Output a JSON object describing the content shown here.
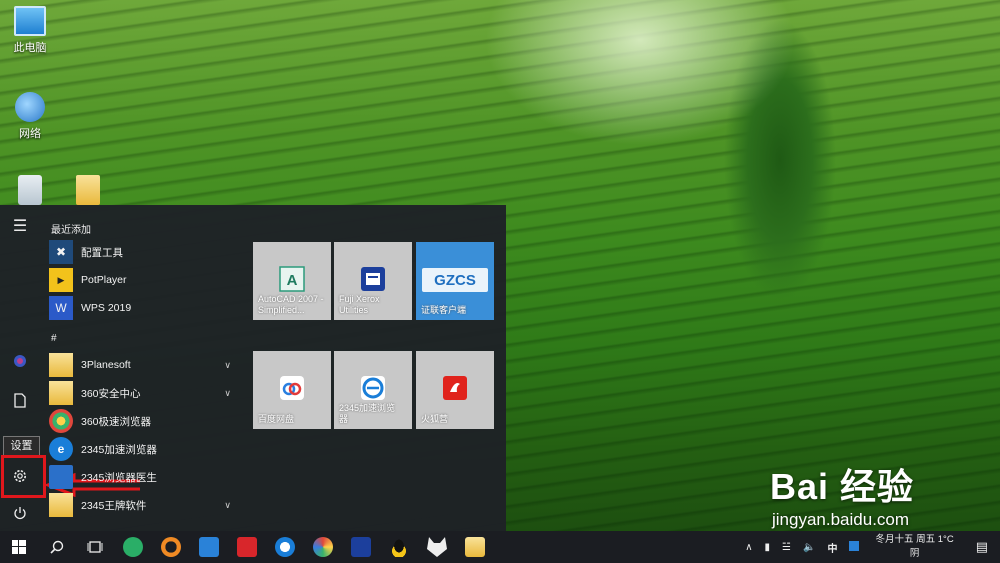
{
  "desktop": {
    "icons": [
      {
        "label": "此电脑",
        "icon": "computer-icon"
      },
      {
        "label": "网络",
        "icon": "network-icon"
      },
      {
        "label": "",
        "icon": "recycle-bin-icon"
      },
      {
        "label": "",
        "icon": "folder-icon"
      }
    ]
  },
  "start_menu": {
    "rail": {
      "menu_icon": "hamburger-menu-icon",
      "tooltip": "设置"
    },
    "recent_header": "最近添加",
    "recent_apps": [
      {
        "label": "配置工具"
      },
      {
        "label": "PotPlayer"
      },
      {
        "label": "WPS 2019"
      }
    ],
    "hash_header": "#",
    "apps": [
      {
        "label": "3Planesoft",
        "expandable": true
      },
      {
        "label": "360安全中心",
        "expandable": true
      },
      {
        "label": "360极速浏览器",
        "expandable": false
      },
      {
        "label": "2345加速浏览器",
        "expandable": false
      },
      {
        "label": "2345浏览器医生",
        "expandable": false
      },
      {
        "label": "2345王牌软件",
        "expandable": true
      }
    ],
    "tiles": [
      {
        "label": "AutoCAD 2007 - Simplified...",
        "icon": "autocad-icon"
      },
      {
        "label": "Fuji Xerox Utilities",
        "icon": "fuji-xerox-icon"
      },
      {
        "label": "证联客户端",
        "icon": "gzcs-icon",
        "logo_text": "GZCS"
      },
      {
        "label": "百度网盘",
        "icon": "baidu-netdisk-icon"
      },
      {
        "label": "2345加速浏览器",
        "icon": "browser-2345-icon"
      },
      {
        "label": "火狐营",
        "icon": "huohu-icon"
      }
    ]
  },
  "taskbar": {
    "apps": [
      "windows-start-icon",
      "search-icon",
      "task-view-icon",
      "wechat-icon",
      "bird-icon",
      "app-grid-icon",
      "news-icon",
      "edge-like-icon",
      "color-wheel-icon",
      "fuji-icon",
      "qq-icon",
      "cat-icon",
      "file-explorer-icon"
    ],
    "tray": {
      "ime": "中",
      "clock_line1": "冬月十五 周五 1°C",
      "clock_line2": "阴"
    }
  },
  "watermark": {
    "logo": "Bai 经验",
    "url": "jingyan.baidu.com"
  },
  "colors": {
    "highlight": "#e0171c",
    "tile_bg": "#c8c8c8",
    "gzcs_tile": "#3a8fd8"
  }
}
